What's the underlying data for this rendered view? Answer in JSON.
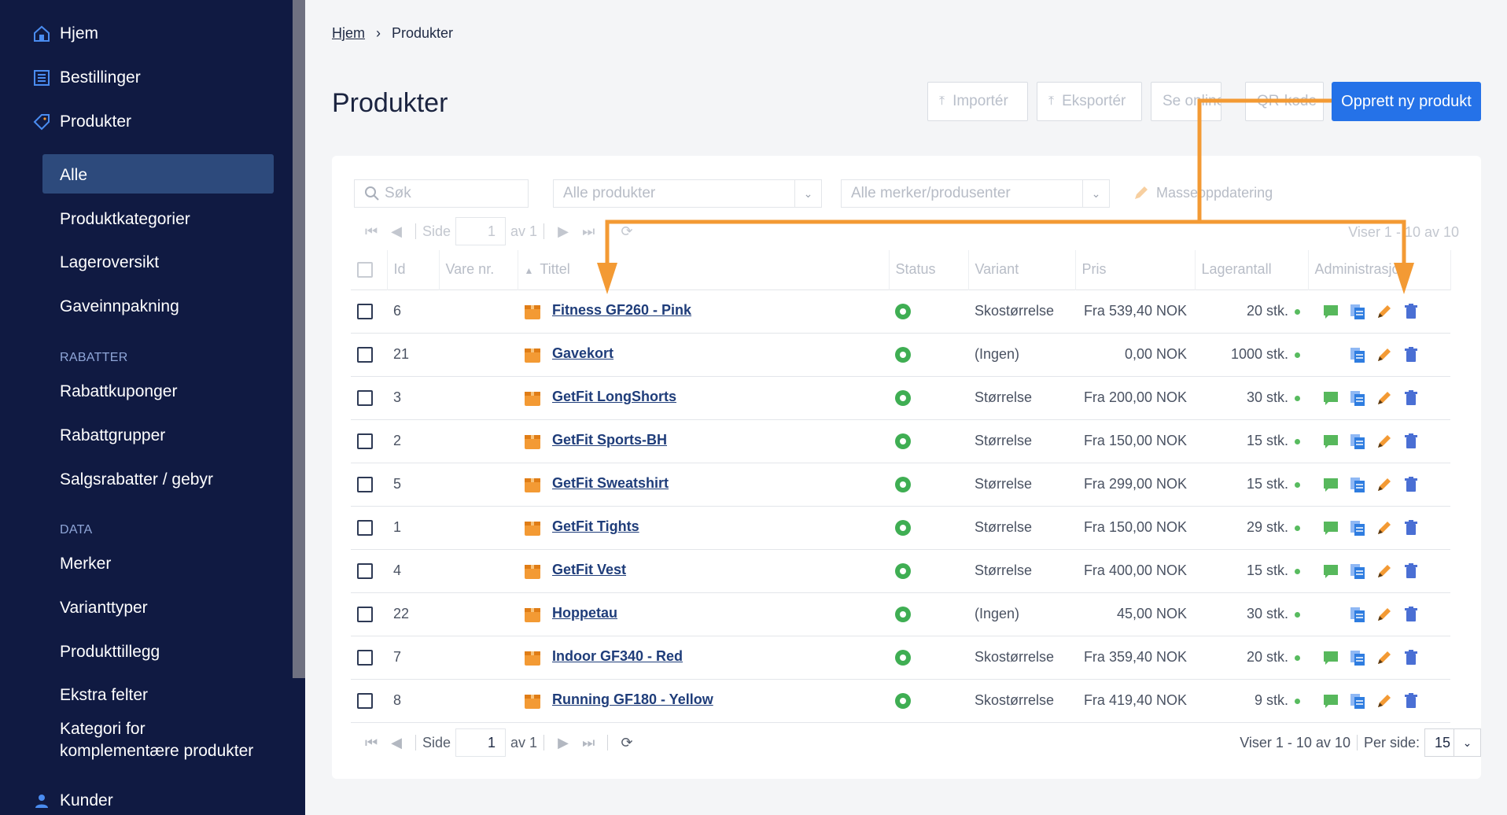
{
  "sidebar": {
    "top_items": [
      "Hjem",
      "Bestillinger",
      "Produkter"
    ],
    "sub_items": [
      "Alle",
      "Produktkategorier",
      "Lageroversikt",
      "Gaveinnpakning"
    ],
    "section_rabatter": "RABATTER",
    "rabatter_items": [
      "Rabattkuponger",
      "Rabattgrupper",
      "Salgsrabatter / gebyr"
    ],
    "section_data": "DATA",
    "data_items": [
      "Merker",
      "Varianttyper",
      "Produkttillegg",
      "Ekstra felter"
    ],
    "kategori_line1": "Kategori for",
    "kategori_line2": "komplementære produkter",
    "kunder": "Kunder"
  },
  "breadcrumb": {
    "home": "Hjem",
    "sep": "›",
    "current": "Produkter"
  },
  "page": {
    "title": "Produkter"
  },
  "header_buttons": {
    "import": "Importér",
    "export": "Eksportér",
    "view_online": "Se online",
    "qr": "QR-kode",
    "create": "Opprett ny produkt"
  },
  "toolbar": {
    "search_placeholder": "Søk",
    "filter_products": "Alle produkter",
    "filter_brands": "Alle merker/produsenter",
    "mass_update": "Masseoppdatering"
  },
  "pager": {
    "side": "Side",
    "page": "1",
    "of": "av 1",
    "showing": "Viser 1 - 10 av 10",
    "per_page_label": "Per side:",
    "per_page": "15"
  },
  "columns": [
    "Id",
    "Vare nr.",
    "Tittel",
    "Status",
    "Variant",
    "Pris",
    "Lagerantall",
    "Administrasjon"
  ],
  "rows": [
    {
      "id": "6",
      "title": "Fitness GF260 - Pink",
      "variant": "Skostørrelse",
      "price": "Fra 539,40 NOK",
      "stock": "20 stk.",
      "comment": true
    },
    {
      "id": "21",
      "title": "Gavekort",
      "variant": "(Ingen)",
      "price": "0,00 NOK",
      "stock": "1000 stk.",
      "comment": false
    },
    {
      "id": "3",
      "title": "GetFit LongShorts",
      "variant": "Størrelse",
      "price": "Fra 200,00 NOK",
      "stock": "30 stk.",
      "comment": true
    },
    {
      "id": "2",
      "title": "GetFit Sports-BH",
      "variant": "Størrelse",
      "price": "Fra 150,00 NOK",
      "stock": "15 stk.",
      "comment": true
    },
    {
      "id": "5",
      "title": "GetFit Sweatshirt",
      "variant": "Størrelse",
      "price": "Fra 299,00 NOK",
      "stock": "15 stk.",
      "comment": true
    },
    {
      "id": "1",
      "title": "GetFit Tights",
      "variant": "Størrelse",
      "price": "Fra 150,00 NOK",
      "stock": "29 stk.",
      "comment": true
    },
    {
      "id": "4",
      "title": "GetFit Vest",
      "variant": "Størrelse",
      "price": "Fra 400,00 NOK",
      "stock": "15 stk.",
      "comment": true
    },
    {
      "id": "22",
      "title": "Hoppetau",
      "variant": "(Ingen)",
      "price": "45,00 NOK",
      "stock": "30 stk.",
      "comment": false
    },
    {
      "id": "7",
      "title": "Indoor GF340 - Red",
      "variant": "Skostørrelse",
      "price": "Fra 359,40 NOK",
      "stock": "20 stk.",
      "comment": true
    },
    {
      "id": "8",
      "title": "Running GF180 - Yellow",
      "variant": "Skostørrelse",
      "price": "Fra 419,40 NOK",
      "stock": "9 stk.",
      "comment": true
    }
  ],
  "colors": {
    "sidebar": "#101a42",
    "primary": "#2572e8",
    "annotation": "#f39a34",
    "status": "#3fae53"
  }
}
